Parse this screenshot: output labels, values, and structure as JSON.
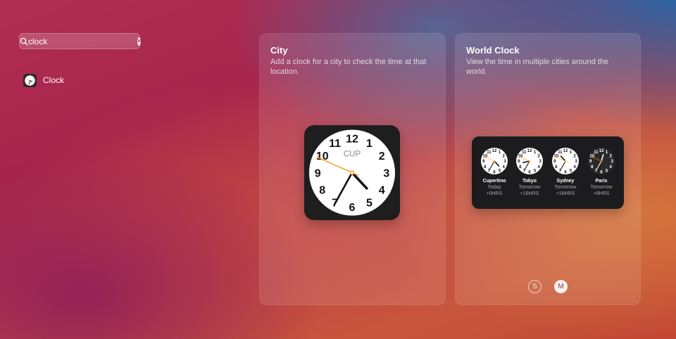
{
  "search": {
    "query": "clock",
    "icon": "magnifying-glass-icon",
    "clear_icon": "clear-x-icon"
  },
  "results": [
    {
      "label": "Clock",
      "icon": "clock-app-icon"
    }
  ],
  "widgets": [
    {
      "title": "City",
      "description": "Add a clock for a city to check the time at that location.",
      "clock": {
        "label": "CUP",
        "hour": 4,
        "minute": 34,
        "second": 49
      }
    },
    {
      "title": "World Clock",
      "description": "View the time in multiple cities around the world.",
      "cities": [
        {
          "name": "Cupertino",
          "day": "Today",
          "offset": "+0HRS",
          "theme": "light",
          "hour": 4,
          "minute": 34
        },
        {
          "name": "Tokyo",
          "day": "Tomorrow",
          "offset": "+16HRS",
          "theme": "light",
          "hour": 8,
          "minute": 34
        },
        {
          "name": "Sydney",
          "day": "Tomorrow",
          "offset": "+18HRS",
          "theme": "light",
          "hour": 10,
          "minute": 34
        },
        {
          "name": "Paris",
          "day": "Tomorrow",
          "offset": "+8HRS",
          "theme": "dark",
          "hour": 12,
          "minute": 34
        }
      ],
      "sizes": [
        {
          "label": "S",
          "selected": false
        },
        {
          "label": "M",
          "selected": true
        }
      ]
    }
  ],
  "colors": {
    "second_hand": "#f09a1a",
    "widget_bg": "#1e1e1e"
  }
}
